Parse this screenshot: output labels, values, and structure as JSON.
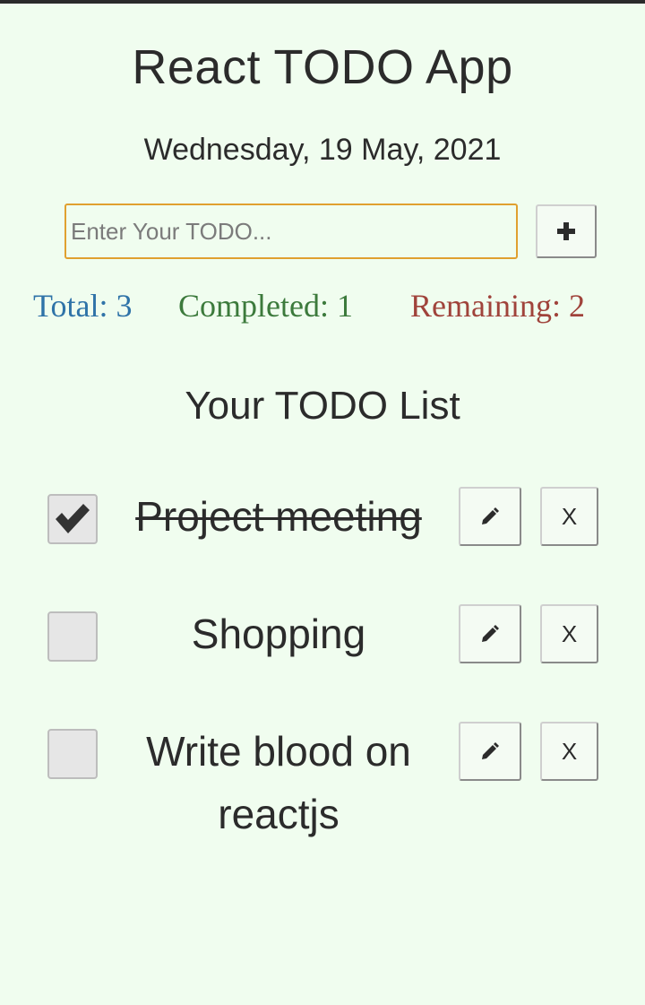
{
  "app": {
    "title": "React TODO App",
    "date": "Wednesday, 19 May, 2021"
  },
  "input": {
    "placeholder": "Enter Your TODO...",
    "value": "",
    "add_icon": "plus-icon"
  },
  "stats": {
    "total": "Total: 3",
    "completed": "Completed: 1",
    "remaining": "Remaining: 2"
  },
  "list": {
    "heading": "Your TODO List",
    "items": [
      {
        "text": "Project meeting",
        "completed": true
      },
      {
        "text": "Shopping",
        "completed": false
      },
      {
        "text": "Write blood on reactjs",
        "completed": false
      }
    ],
    "edit_icon": "pencil-icon",
    "delete_label": "X"
  },
  "colors": {
    "background": "#f0fdef",
    "total": "#2f73a8",
    "completed": "#3c7a3c",
    "remaining": "#a0433b",
    "input_border": "#e0a030"
  }
}
